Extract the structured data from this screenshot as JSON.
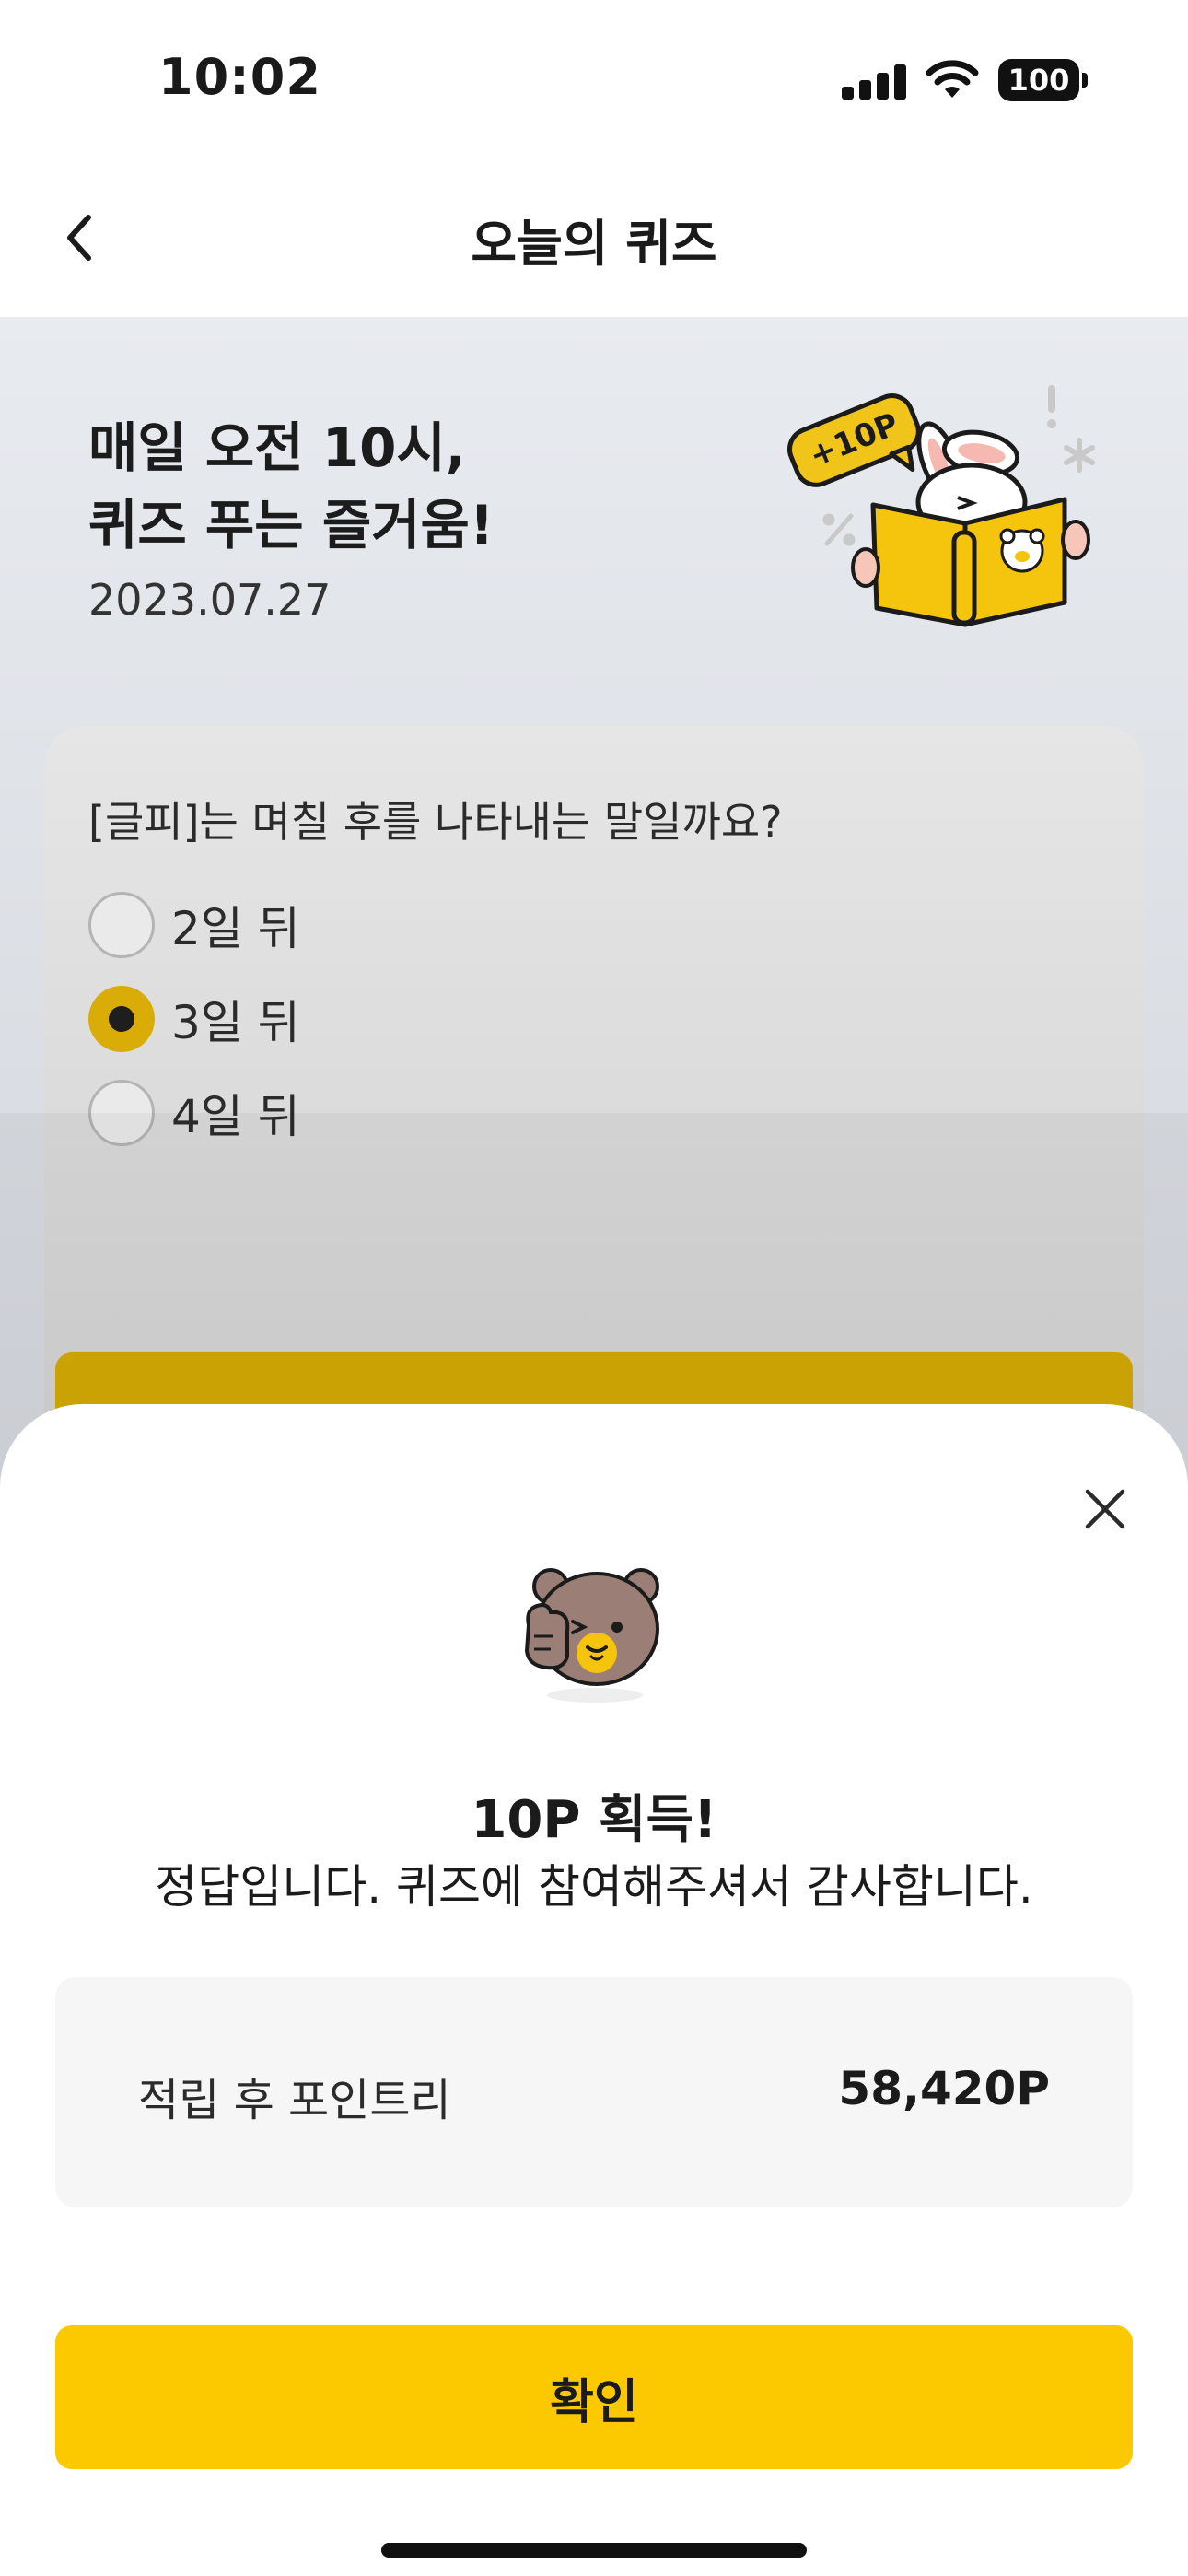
{
  "status_bar": {
    "time": "10:02",
    "battery": "100"
  },
  "nav": {
    "title": "오늘의 퀴즈"
  },
  "hero": {
    "title_line1": "매일 오전 10시,",
    "title_line2": "퀴즈 푸는 즐거움!",
    "date": "2023.07.27",
    "badge": "+10P"
  },
  "quiz": {
    "question": "[글피]는 며칠 후를 나타내는 말일까요?",
    "options": [
      {
        "label": "2일 뒤",
        "selected": false
      },
      {
        "label": "3일 뒤",
        "selected": true
      },
      {
        "label": "4일 뒤",
        "selected": false
      }
    ]
  },
  "sheet": {
    "title": "10P 획득!",
    "message": "정답입니다. 퀴즈에 참여해주셔서 감사합니다.",
    "points_label": "적립 후 포인트리",
    "points_value": "58,420P",
    "confirm_label": "확인"
  },
  "colors": {
    "accent": "#FCC900",
    "accent_dimmed": "#D4A905",
    "text": "#1B1B1B"
  }
}
